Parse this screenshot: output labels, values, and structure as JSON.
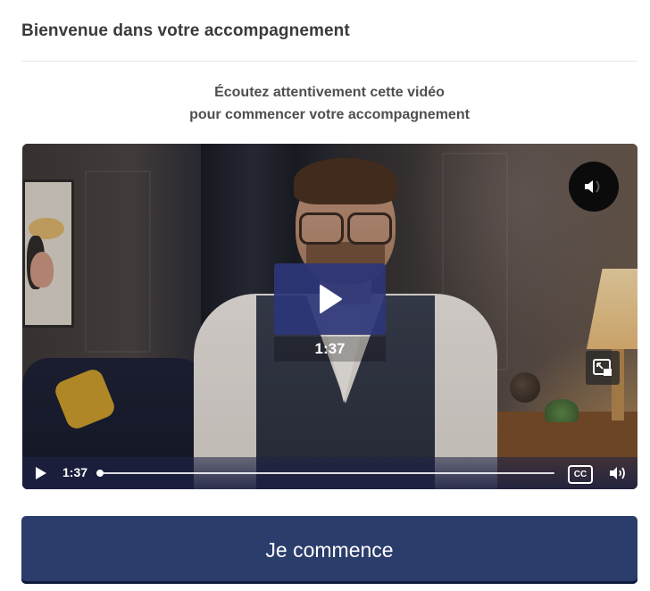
{
  "header": {
    "title": "Bienvenue dans votre accompagnement"
  },
  "intro": {
    "line1": "Écoutez attentivement cette vidéo",
    "line2": "pour commencer votre accompagnement"
  },
  "video": {
    "duration_overlay": "1:37",
    "current_time": "1:37",
    "captions_label": "CC",
    "progress_fraction": 0.0,
    "icons": {
      "mute": "speaker-muted-icon",
      "play": "play-icon",
      "pip": "picture-in-picture-icon",
      "controls_play": "play-icon",
      "volume": "volume-icon",
      "captions": "closed-captions-icon"
    }
  },
  "cta": {
    "label": "Je commence"
  },
  "colors": {
    "accent": "#2b3d6b",
    "play_overlay": "#2c3678",
    "text_dark": "#3a3a3a",
    "divider": "#e6e6e6"
  }
}
